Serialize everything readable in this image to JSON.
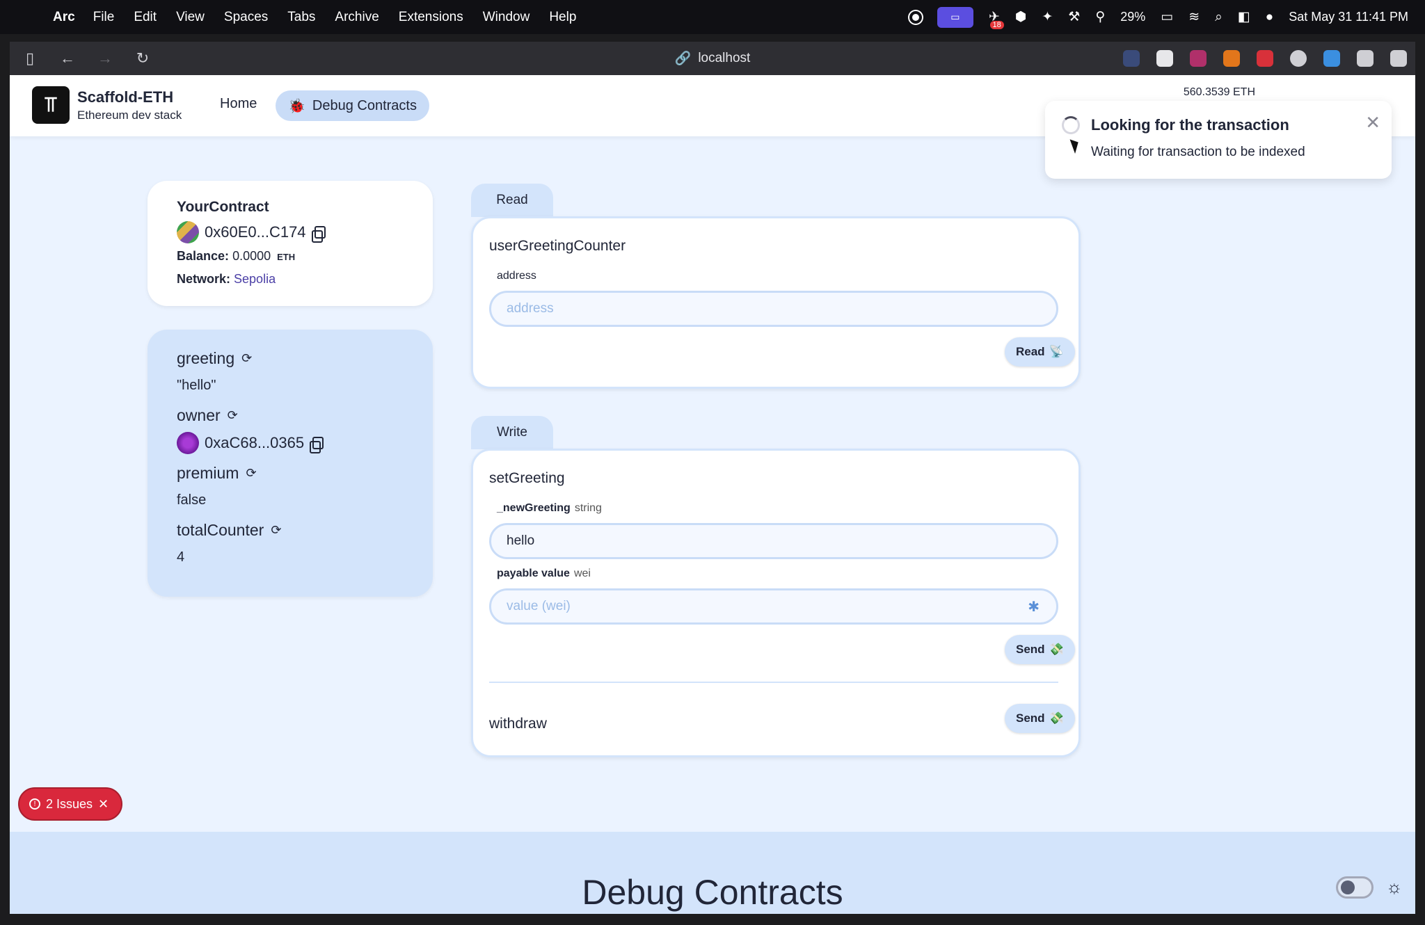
{
  "menubar": {
    "app_name": "Arc",
    "items": [
      "File",
      "Edit",
      "View",
      "Spaces",
      "Tabs",
      "Archive",
      "Extensions",
      "Window",
      "Help"
    ],
    "battery": "29%",
    "badge_count": "18",
    "datetime": "Sat May 31  11:41 PM"
  },
  "browser": {
    "url": "localhost"
  },
  "header": {
    "brand_title": "Scaffold-ETH",
    "brand_subtitle": "Ethereum dev stack",
    "nav_home": "Home",
    "nav_debug": "Debug Contracts",
    "balance_partial": "560.3539 ETH"
  },
  "contract": {
    "name": "YourContract",
    "address": "0x60E0...C174",
    "balance_label": "Balance:",
    "balance_value": "0.0000",
    "balance_unit": "ETH",
    "network_label": "Network:",
    "network_value": "Sepolia"
  },
  "vars": {
    "greeting_label": "greeting",
    "greeting_value": "\"hello\"",
    "owner_label": "owner",
    "owner_value": "0xaC68...0365",
    "premium_label": "premium",
    "premium_value": "false",
    "total_label": "totalCounter",
    "total_value": "4"
  },
  "read": {
    "tab": "Read",
    "fn_name": "userGreetingCounter",
    "param_label": "address",
    "placeholder": "address",
    "button": "Read"
  },
  "write": {
    "tab": "Write",
    "fn_name": "setGreeting",
    "param_name": "_newGreeting",
    "param_type": "string",
    "param_value": "hello",
    "payable_label": "payable value",
    "payable_type": "wei",
    "payable_placeholder": "value (wei)",
    "send_button": "Send",
    "withdraw_name": "withdraw",
    "withdraw_button": "Send"
  },
  "toast": {
    "title": "Looking for the transaction",
    "description": "Waiting for transaction to be indexed"
  },
  "footer": {
    "title": "Debug Contracts",
    "issues": "2 Issues"
  }
}
